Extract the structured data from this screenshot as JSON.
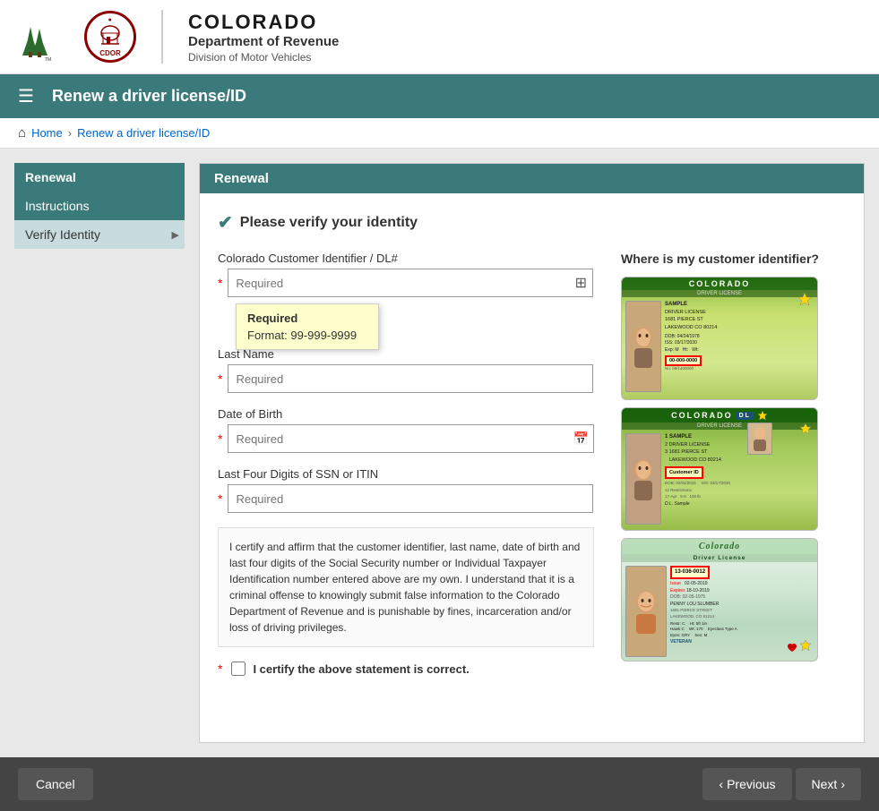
{
  "header": {
    "state": "COLORADO",
    "dept": "Department of Revenue",
    "division": "Division of Motor Vehicles"
  },
  "navbar": {
    "menu_icon": "☰",
    "title": "Renew a driver license/ID"
  },
  "breadcrumb": {
    "home": "Home",
    "current": "Renew a driver license/ID"
  },
  "sidebar": {
    "header": "Renewal",
    "items": [
      {
        "label": "Instructions",
        "state": "active"
      },
      {
        "label": "Verify Identity",
        "state": "current"
      }
    ]
  },
  "content": {
    "header": "Renewal",
    "verify_title": "Please verify your identity",
    "fields": {
      "customer_id_label": "Colorado Customer Identifier / DL#",
      "customer_id_placeholder": "Required",
      "last_name_label": "Last Name",
      "last_name_placeholder": "Required",
      "dob_label": "Date of Birth",
      "dob_placeholder": "Required",
      "ssn_label": "Last Four Digits of SSN or ITIN",
      "ssn_placeholder": "Required"
    },
    "tooltip": {
      "required": "Required",
      "format": "Format: 99-999-9999"
    },
    "identifier_title": "Where is my customer identifier?",
    "cert_text": "I certify and affirm that the customer identifier, last name, date of birth and last four digits of the Social Security number or Individual Taxpayer Identification number entered above are my own. I understand that it is a criminal offense to knowingly submit false information to the Colorado Department of Revenue and is punishable by fines, incarceration and/or loss of driving privileges.",
    "cert_checkbox_label": "I certify the above statement is correct."
  },
  "footer": {
    "cancel_label": "Cancel",
    "previous_label": "Previous",
    "next_label": "Next",
    "prev_icon": "‹",
    "next_icon": "›"
  }
}
